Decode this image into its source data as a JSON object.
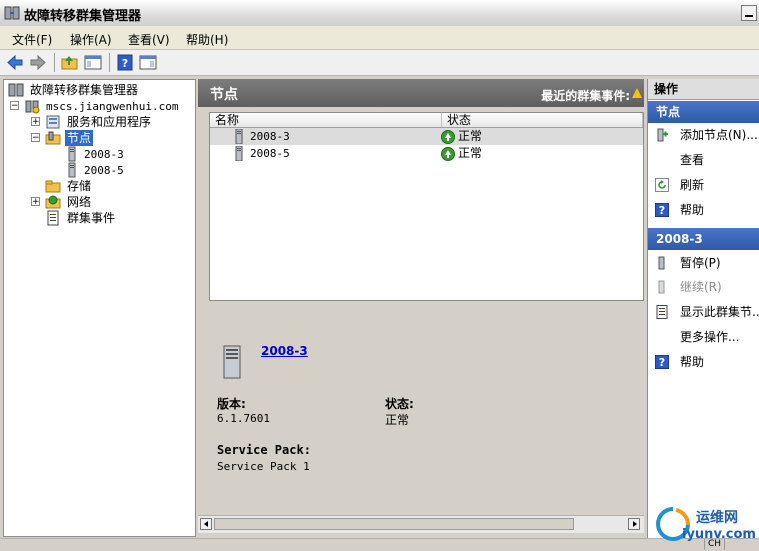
{
  "window": {
    "title": "故障转移群集管理器"
  },
  "menu": [
    {
      "label": "文件(F)"
    },
    {
      "label": "操作(A)"
    },
    {
      "label": "查看(V)"
    },
    {
      "label": "帮助(H)"
    }
  ],
  "tree": {
    "root": "故障转移群集管理器",
    "cluster": "mscs.jiangwenhui.com",
    "services": "服务和应用程序",
    "nodes": "节点",
    "node1": "2008-3",
    "node2": "2008-5",
    "storage": "存储",
    "network": "网络",
    "events": "群集事件"
  },
  "center": {
    "title": "节点",
    "recent_events": "最近的群集事件:",
    "columns": [
      "名称",
      "状态"
    ],
    "rows": [
      {
        "name": "2008-3",
        "status": "正常"
      },
      {
        "name": "2008-5",
        "status": "正常"
      }
    ],
    "detail": {
      "name": "2008-3",
      "version_label": "版本:",
      "version": "6.1.7601",
      "status_label": "状态:",
      "status": "正常",
      "sp_label": "Service Pack:",
      "sp": "Service Pack 1"
    }
  },
  "actions": {
    "title": "操作",
    "section1": "节点",
    "add_node": "添加节点(N)...",
    "view": "查看",
    "refresh": "刷新",
    "help1": "帮助",
    "section2": "2008-3",
    "pause": "暂停(P)",
    "resume": "继续(R)",
    "show_events": "显示此群集节...",
    "more": "更多操作...",
    "help2": "帮助"
  },
  "statusbar": {
    "ime": "CH"
  },
  "watermark": {
    "text1": "运维网",
    "text2": "iyunv.com"
  },
  "colors": {
    "selection": "#316ac5",
    "section_header": "#2f5aa8",
    "pane_header": "#6a6a6a",
    "ok_green": "#3c9a32"
  }
}
